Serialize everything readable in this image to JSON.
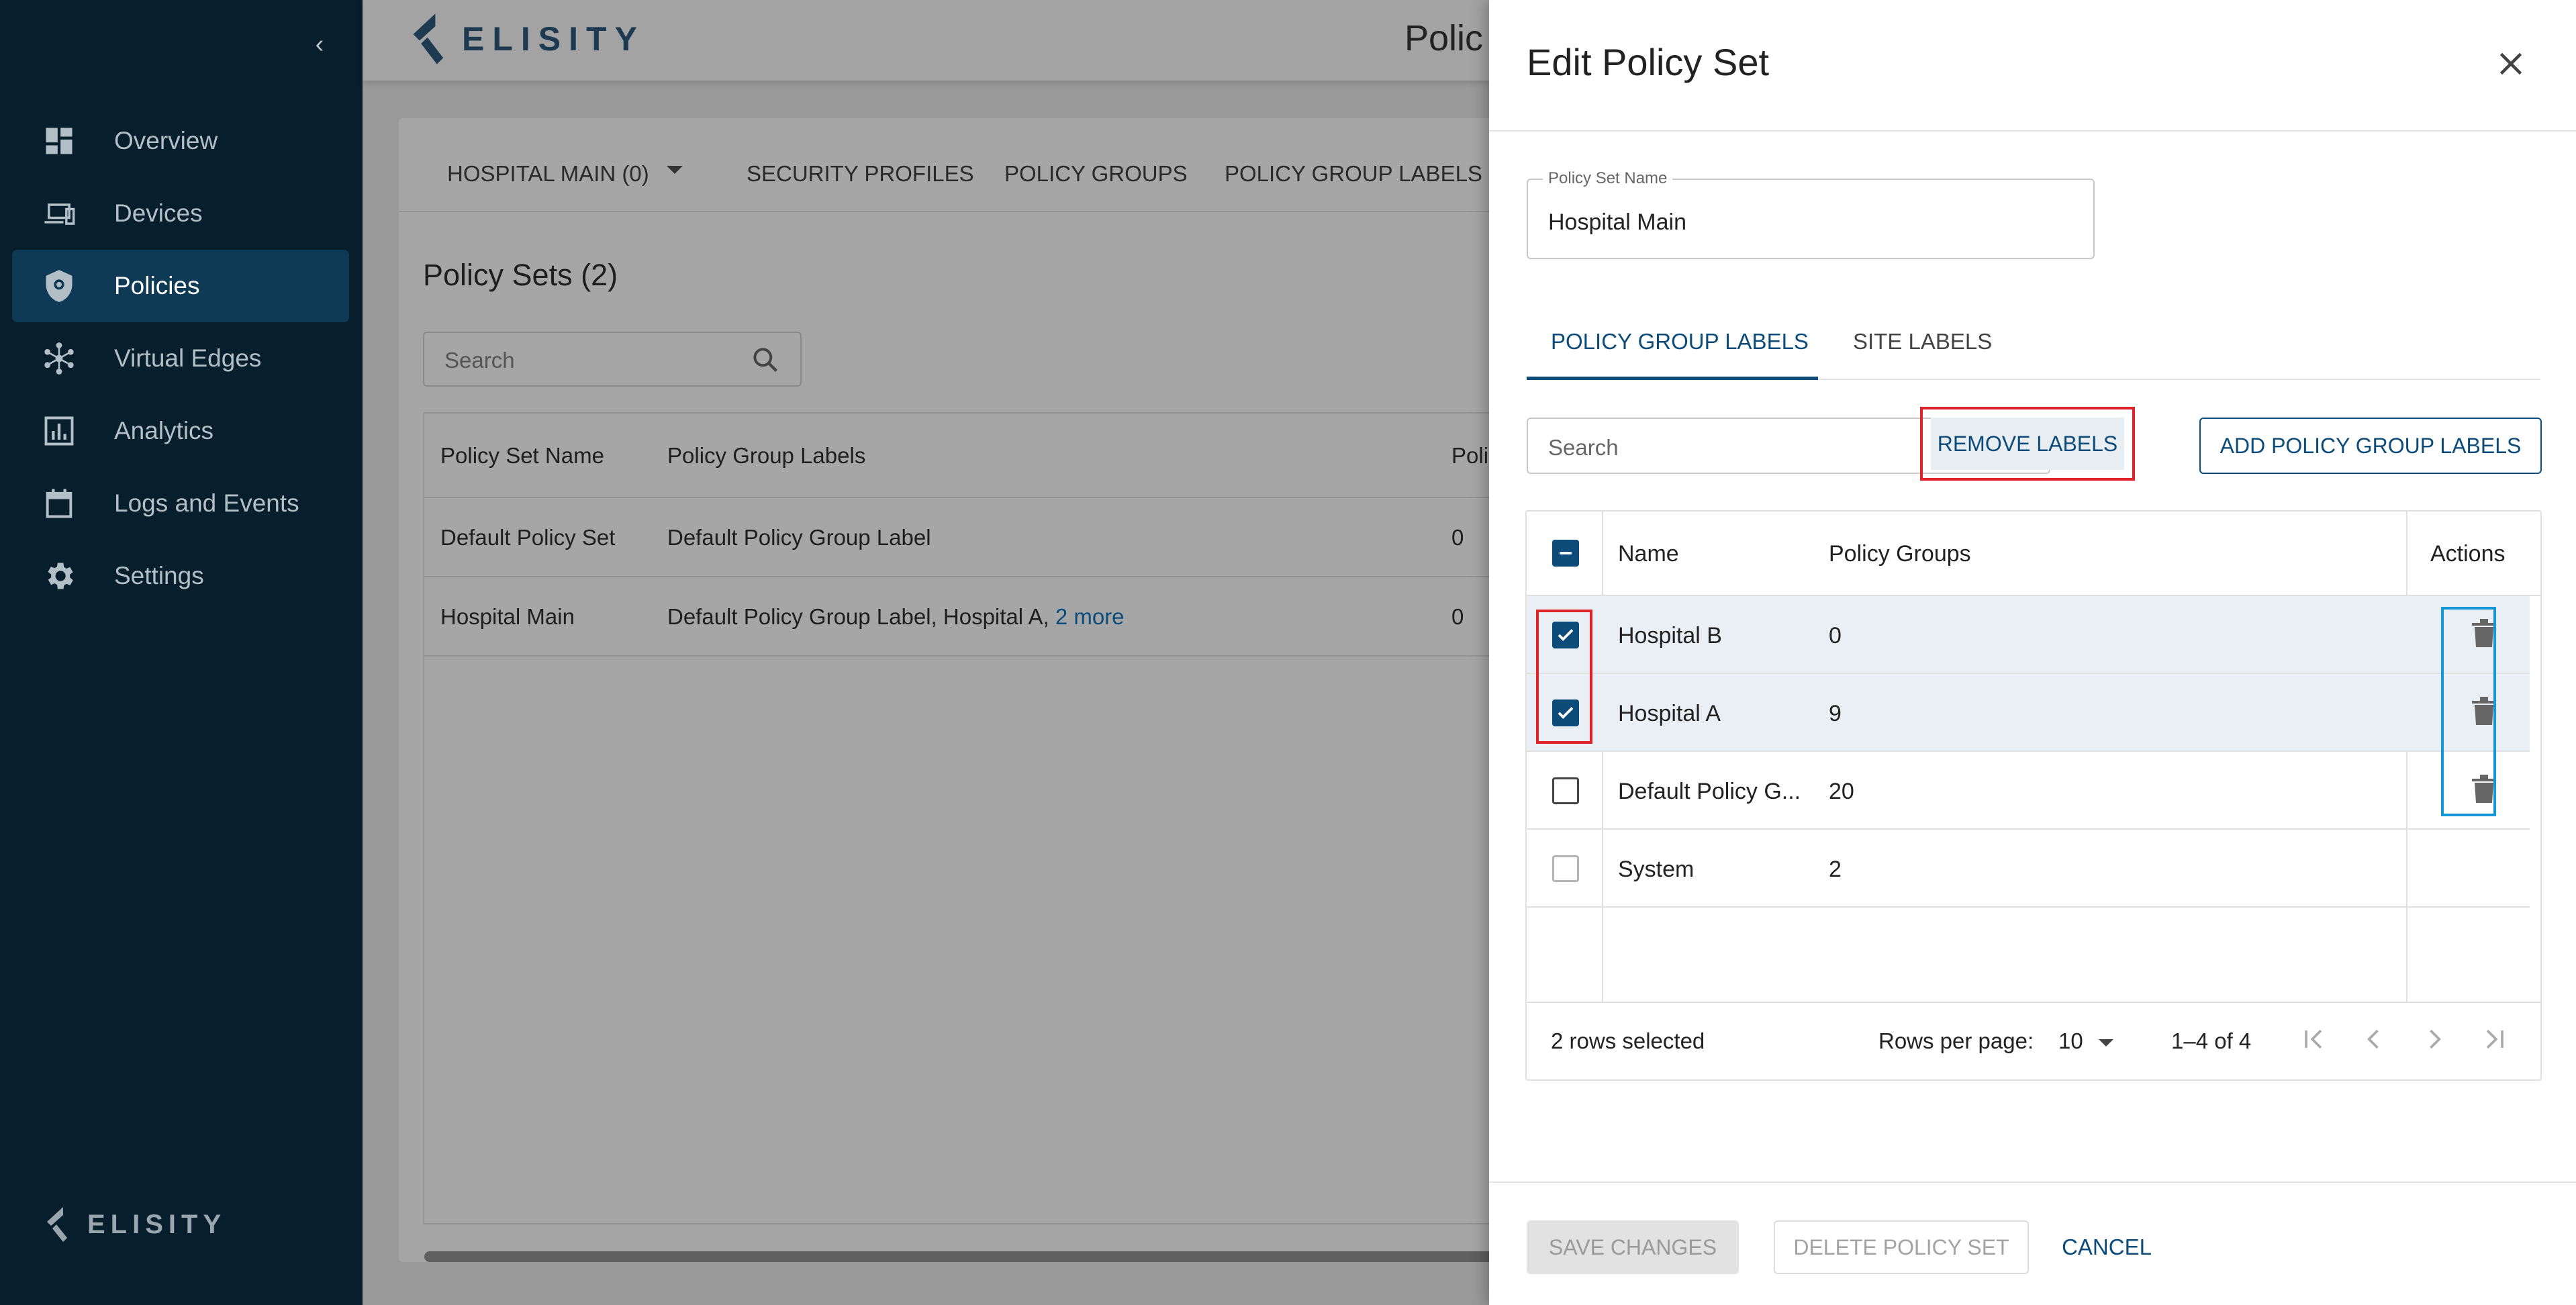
{
  "sidebar": {
    "collapse_icon": "chevron-left-icon",
    "items": [
      {
        "label": "Overview",
        "icon": "dashboard-icon",
        "active": false
      },
      {
        "label": "Devices",
        "icon": "devices-icon",
        "active": false
      },
      {
        "label": "Policies",
        "icon": "shield-icon",
        "active": true
      },
      {
        "label": "Virtual Edges",
        "icon": "network-icon",
        "active": false
      },
      {
        "label": "Analytics",
        "icon": "chart-icon",
        "active": false
      },
      {
        "label": "Logs and Events",
        "icon": "calendar-icon",
        "active": false
      },
      {
        "label": "Settings",
        "icon": "gear-icon",
        "active": false
      }
    ],
    "logo_text": "ELISITY"
  },
  "topbar": {
    "logo_text": "ELISITY",
    "page_heading": "Polic"
  },
  "background": {
    "tabs": [
      {
        "label": "HOSPITAL MAIN (0)"
      },
      {
        "label": "SECURITY PROFILES"
      },
      {
        "label": "POLICY GROUPS"
      },
      {
        "label": "POLICY GROUP LABELS"
      }
    ],
    "title": "Policy Sets (2)",
    "search_placeholder": "Search",
    "table": {
      "headers": [
        "Policy Set Name",
        "Policy Group Labels",
        "Poli"
      ],
      "rows": [
        {
          "name": "Default Policy Set",
          "labels": "Default Policy Group Label",
          "more": "",
          "count": "0"
        },
        {
          "name": "Hospital Main",
          "labels": "Default Policy Group Label, Hospital A,",
          "more": "2 more",
          "count": "0"
        }
      ]
    }
  },
  "drawer": {
    "title": "Edit Policy Set",
    "name_field": {
      "label": "Policy Set Name",
      "value": "Hospital Main"
    },
    "tabs": [
      {
        "label": "POLICY GROUP LABELS",
        "active": true
      },
      {
        "label": "SITE LABELS",
        "active": false
      }
    ],
    "search_placeholder": "Search",
    "remove_labels_button": "REMOVE LABELS",
    "add_button": "ADD POLICY GROUP LABELS",
    "grid": {
      "headers": {
        "name": "Name",
        "groups": "Policy Groups",
        "actions": "Actions"
      },
      "rows": [
        {
          "name": "Hospital B",
          "groups": "0",
          "checked": true
        },
        {
          "name": "Hospital A",
          "groups": "9",
          "checked": true
        },
        {
          "name": "Default Policy G...",
          "groups": "20",
          "checked": false
        },
        {
          "name": "System",
          "groups": "2",
          "checked": false
        }
      ],
      "footer": {
        "selected": "2 rows selected",
        "rows_per_page_label": "Rows per page:",
        "rows_per_page_value": "10",
        "range": "1–4 of 4"
      }
    },
    "footer": {
      "save": "SAVE CHANGES",
      "delete": "DELETE POLICY SET",
      "cancel": "CANCEL"
    }
  },
  "colors": {
    "sidebar_bg": "#071f2d",
    "active_nav_bg": "#0f3a56",
    "primary": "#0d4c7a",
    "highlight_red": "#e0222a",
    "highlight_blue": "#1798d6"
  }
}
